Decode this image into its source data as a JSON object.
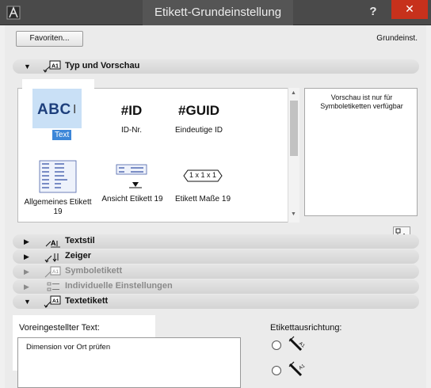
{
  "window": {
    "title": "Etikett-Grundeinstellung",
    "help_glyph": "?",
    "close_glyph": "✕"
  },
  "toolbar": {
    "favoriten_label": "Favoriten...",
    "grundeinst_label": "Grundeinst."
  },
  "sections": {
    "typ": {
      "label": "Typ und Vorschau",
      "icon_text": "A1"
    },
    "textstil": {
      "label": "Textstil"
    },
    "zeiger": {
      "label": "Zeiger"
    },
    "symboletikett": {
      "label": "Symboletikett",
      "icon_text": "A1"
    },
    "individuell": {
      "label": "Individuelle Einstellungen"
    },
    "textetikett": {
      "label": "Textetikett",
      "icon_text": "A1"
    }
  },
  "types": {
    "text": {
      "preview": "ABC",
      "label": "Text"
    },
    "id": {
      "preview": "#ID",
      "label": "ID-Nr."
    },
    "guid": {
      "preview": "#GUID",
      "label": "Eindeutige ID"
    },
    "allgemein": {
      "label": "Allgemeines Etikett 19"
    },
    "ansicht": {
      "label": "Ansicht Etikett 19"
    },
    "masse": {
      "preview": "1 x 1 x 1",
      "label": "Etikett Maße 19"
    }
  },
  "preview_note": "Vorschau ist nur für Symboletiketten verfügbar",
  "textetikett": {
    "default_text_label": "Voreingestellter Text:",
    "default_text_value": "Dimension vor Ort prüfen",
    "alignment_label": "Etikettausrichtung:"
  },
  "colors": {
    "titlebar": "#4a4a4a",
    "close": "#c7311c",
    "selection": "#3c86d8",
    "selected_item_bg": "#c9e0f6"
  }
}
